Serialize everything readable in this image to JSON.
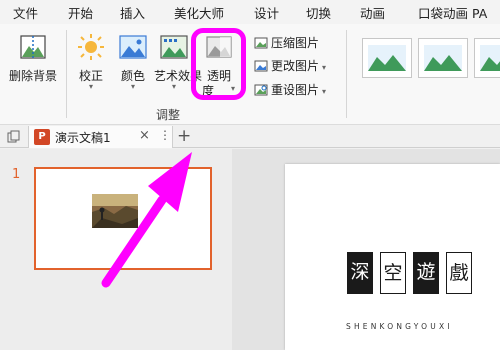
{
  "menu": {
    "items": [
      "文件",
      "开始",
      "插入",
      "美化大师",
      "设计",
      "切换",
      "动画",
      "口袋动画 PA"
    ]
  },
  "ribbon": {
    "remove_bg": "删除背景",
    "correct": "校正",
    "color": "颜色",
    "artistic": "艺术效果",
    "transparency": [
      "透明",
      "度"
    ],
    "compress": "压缩图片",
    "change": "更改图片",
    "reset": "重设图片",
    "group_label": "调整"
  },
  "tabs": {
    "doc_title": "演示文稿1",
    "ppt_badge": "P",
    "close_glyph": "×",
    "more_glyph": "⋮",
    "add_glyph": "+"
  },
  "slides": {
    "number": "1"
  },
  "slide_content": {
    "seal_chars": [
      "深",
      "空",
      "遊",
      "戲"
    ],
    "brand_sub": "SHENKONGYOUXI"
  },
  "colors": {
    "highlight": "#ff00ff",
    "ppt_accent": "#d24726",
    "slide_border": "#e2622c"
  }
}
